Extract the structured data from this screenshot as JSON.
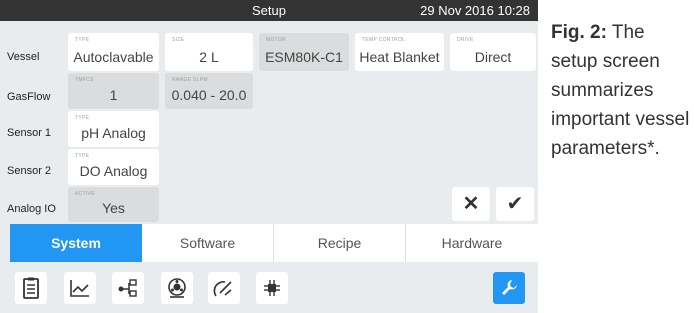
{
  "window": {
    "title": "Setup",
    "datetime": "29 Nov 2016 10:28"
  },
  "rows": {
    "vessel": {
      "label": "Vessel",
      "type": {
        "caption": "TYPE",
        "value": "Autoclavable"
      },
      "size": {
        "caption": "SIZE",
        "value": "2 L"
      },
      "motor": {
        "caption": "MOTOR",
        "value": "ESM80K-C1"
      },
      "temp": {
        "caption": "TEMP CONTROL",
        "value": "Heat Blanket"
      },
      "drive": {
        "caption": "DRIVE",
        "value": "Direct"
      }
    },
    "gasflow": {
      "label": "GasFlow",
      "tmfcs": {
        "caption": "TMFCS",
        "value": "1"
      },
      "range": {
        "caption": "RANGE SLPM",
        "value": "0.040 - 20.0"
      }
    },
    "sensor1": {
      "label": "Sensor 1",
      "type": {
        "caption": "TYPE",
        "value": "pH Analog"
      }
    },
    "sensor2": {
      "label": "Sensor 2",
      "type": {
        "caption": "TYPE",
        "value": "DO Analog"
      }
    },
    "analog": {
      "label": "Analog IO",
      "active": {
        "caption": "ACTIVE",
        "value": "Yes"
      }
    }
  },
  "actions": {
    "cancel": "✕",
    "confirm": "✔"
  },
  "tabs": [
    "System",
    "Software",
    "Recipe",
    "Hardware"
  ],
  "active_tab": "System",
  "toolbar_icons": [
    "clipboard-icon",
    "trend-chart-icon",
    "network-icon",
    "pump-icon",
    "gauge-icon",
    "chip-icon",
    "wrench-icon"
  ],
  "colors": {
    "accent": "#2196f3",
    "topbar": "#333333",
    "background": "#e9ecef"
  },
  "caption": {
    "bold": "Fig. 2:",
    "text": " The setup screen summarizes important vessel parameters*."
  }
}
